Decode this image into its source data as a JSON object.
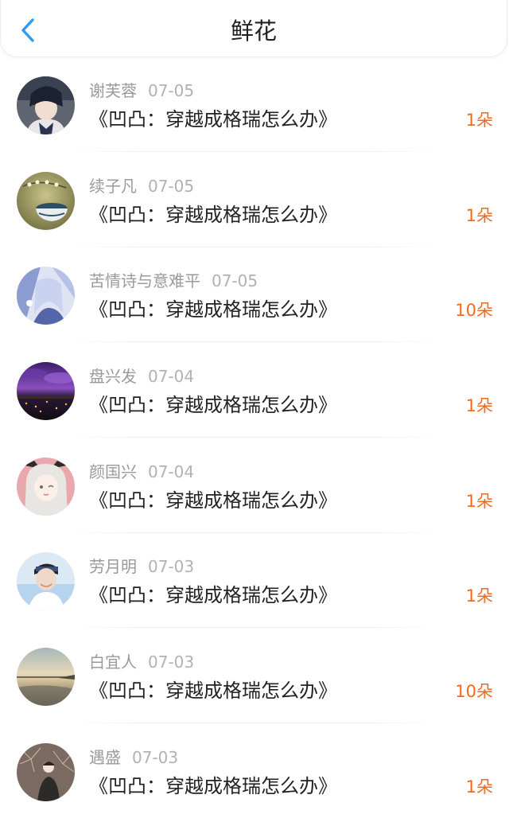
{
  "header": {
    "title": "鲜花",
    "back_icon": "chevron-left-icon",
    "accent_color": "#2f9bf0"
  },
  "count_color": "#f36a1c",
  "items": [
    {
      "user": "谢芙蓉",
      "date": "07-05",
      "book": "《凹凸：穿越成格瑞怎么办》",
      "count": "1朵",
      "avatar_icon": "avatar-anime-boy-icon"
    },
    {
      "user": "续子凡",
      "date": "07-05",
      "book": "《凹凸：穿越成格瑞怎么办》",
      "count": "1朵",
      "avatar_icon": "avatar-teacup-icon"
    },
    {
      "user": "苦情诗与意难平",
      "date": "07-05",
      "book": "《凹凸：穿越成格瑞怎么办》",
      "count": "10朵",
      "avatar_icon": "avatar-anime-girl-blue-icon"
    },
    {
      "user": "盘兴发",
      "date": "07-04",
      "book": "《凹凸：穿越成格瑞怎么办》",
      "count": "1朵",
      "avatar_icon": "avatar-night-city-icon"
    },
    {
      "user": "颜国兴",
      "date": "07-04",
      "book": "《凹凸：穿越成格瑞怎么办》",
      "count": "1朵",
      "avatar_icon": "avatar-anime-girl-pink-icon"
    },
    {
      "user": "劳月明",
      "date": "07-03",
      "book": "《凹凸：穿越成格瑞怎么办》",
      "count": "1朵",
      "avatar_icon": "avatar-boy-photo-icon"
    },
    {
      "user": "白宜人",
      "date": "07-03",
      "book": "《凹凸：穿越成格瑞怎么办》",
      "count": "10朵",
      "avatar_icon": "avatar-sunset-sea-icon"
    },
    {
      "user": "遇盛",
      "date": "07-03",
      "book": "《凹凸：穿越成格瑞怎么办》",
      "count": "1朵",
      "avatar_icon": "avatar-fireworks-icon"
    }
  ]
}
